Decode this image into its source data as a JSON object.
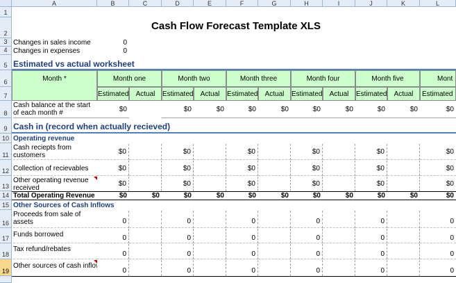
{
  "columns": [
    "A",
    "B",
    "C",
    "D",
    "E",
    "F",
    "G",
    "H",
    "I",
    "J",
    "K",
    "L"
  ],
  "rows": [
    "1",
    "2",
    "3",
    "4",
    "5",
    "6",
    "7",
    "8",
    "9",
    "10",
    "11",
    "12",
    "13",
    "14",
    "15",
    "16",
    "17",
    "18",
    "19"
  ],
  "title": "Cash Flow Forecast Template XLS",
  "changes": {
    "sales_label": "Changes in sales income",
    "sales_value": "0",
    "expenses_label": "Changes in expenses",
    "expenses_value": "0"
  },
  "sections": {
    "estimated_vs_actual": "Estimated vs actual worksheet",
    "cash_in": "Cash in (record when actually recieved)",
    "operating_revenue": "Operating revenue",
    "other_sources": "Other Sources of Cash Inflows"
  },
  "header": {
    "month_label": "Month *",
    "months": [
      "Month one",
      "Month two",
      "Month three",
      "Month four",
      "Month five",
      "Mont"
    ],
    "estimated": "Estimated",
    "actual": "Actual"
  },
  "rows_data": {
    "cash_balance": {
      "label": "Cash balance at the start of each month #",
      "value": "$0"
    },
    "cash_receipts": {
      "label": "Cash reciepts from customers",
      "value": "$0"
    },
    "collection": {
      "label": "Collection of recievables",
      "value": "$0"
    },
    "other_operating": {
      "label": "Other operating revenue received",
      "value": "$0"
    },
    "total_operating": {
      "label": "Total Operating Revenue",
      "value": "$0"
    },
    "proceeds": {
      "label": "Proceeds from sale of assets",
      "value": "0"
    },
    "funds": {
      "label": "Funds borrowed",
      "value": "0"
    },
    "tax": {
      "label": "Tax refund/rebates",
      "value": "0"
    },
    "other_inflow": {
      "label": "Other sources of cash inflow",
      "value": "0"
    }
  }
}
